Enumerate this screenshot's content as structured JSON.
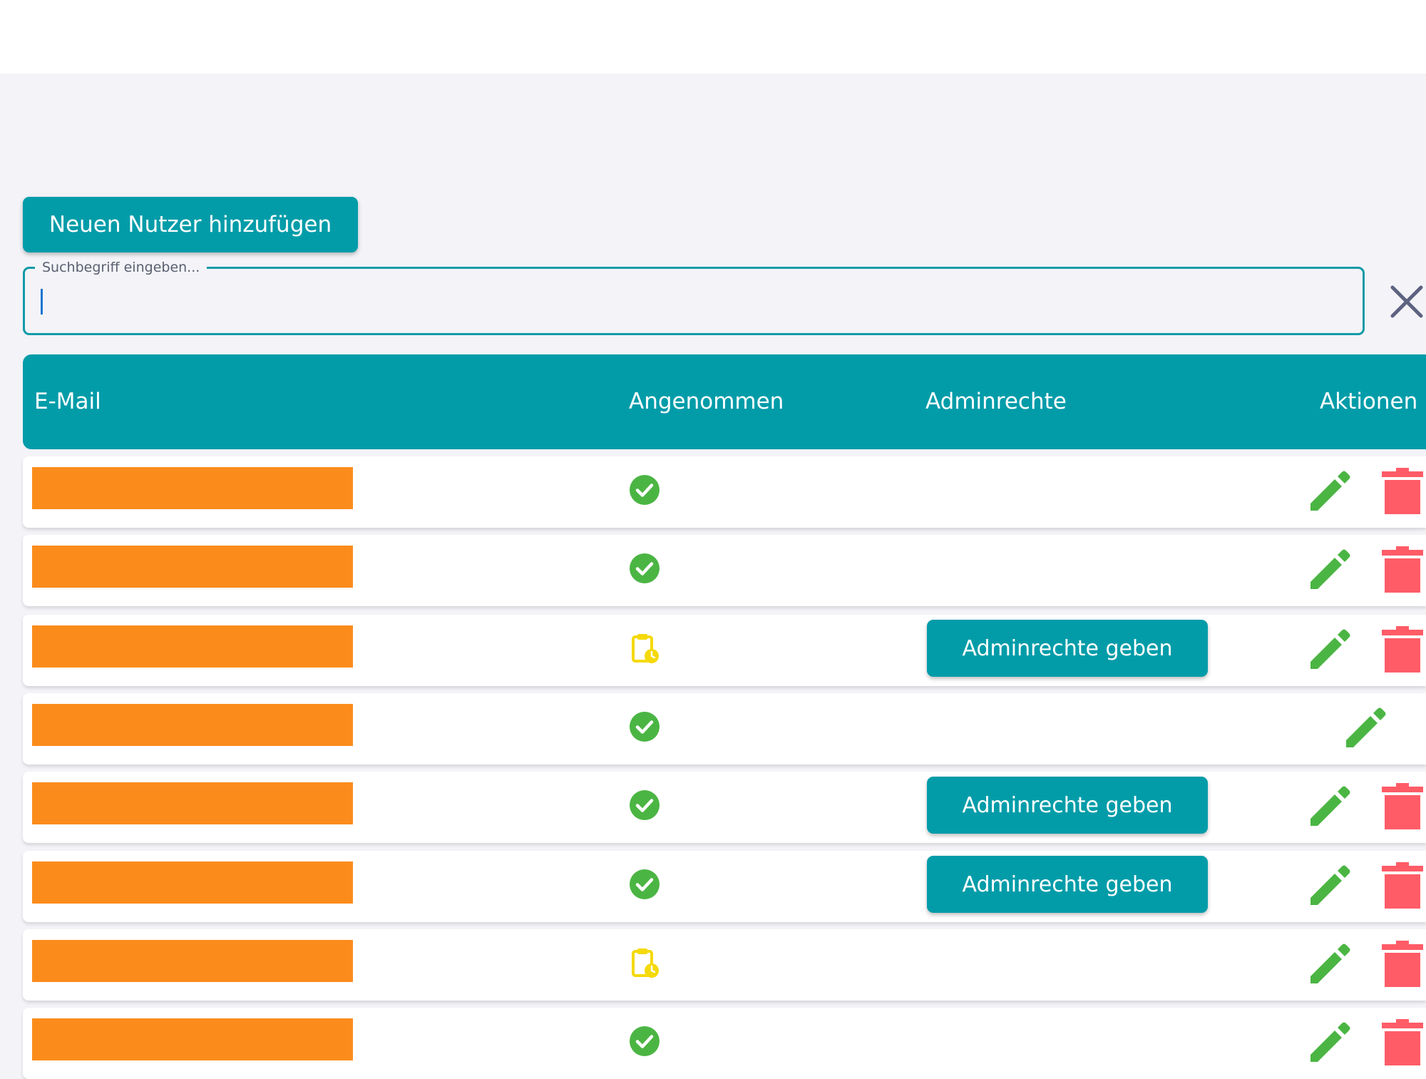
{
  "toolbar": {
    "add_user_label": "Neuen Nutzer hinzufügen"
  },
  "search": {
    "label": "Suchbegriff eingeben...",
    "value": ""
  },
  "table": {
    "headers": {
      "email": "E-Mail",
      "accepted": "Angenommen",
      "admin": "Adminrechte",
      "actions": "Aktionen"
    },
    "admin_button_label": "Adminrechte geben",
    "rows": [
      {
        "accepted": true,
        "admin_button": false,
        "deletable": true
      },
      {
        "accepted": true,
        "admin_button": false,
        "deletable": true
      },
      {
        "accepted": false,
        "admin_button": true,
        "deletable": true
      },
      {
        "accepted": true,
        "admin_button": false,
        "deletable": false
      },
      {
        "accepted": true,
        "admin_button": true,
        "deletable": true
      },
      {
        "accepted": true,
        "admin_button": true,
        "deletable": true
      },
      {
        "accepted": false,
        "admin_button": false,
        "deletable": true
      },
      {
        "accepted": true,
        "admin_button": false,
        "deletable": true
      }
    ]
  },
  "icons": {
    "accepted": "check-circle-icon",
    "pending": "clipboard-clock-icon",
    "edit": "pencil-icon",
    "delete": "trash-icon",
    "clear": "close-icon"
  },
  "colors": {
    "primary": "#029ca9",
    "accepted": "#4bb543",
    "pending": "#f5d90a",
    "edit": "#4bb543",
    "delete": "#ff5c67",
    "redaction": "#fb8c1c"
  }
}
